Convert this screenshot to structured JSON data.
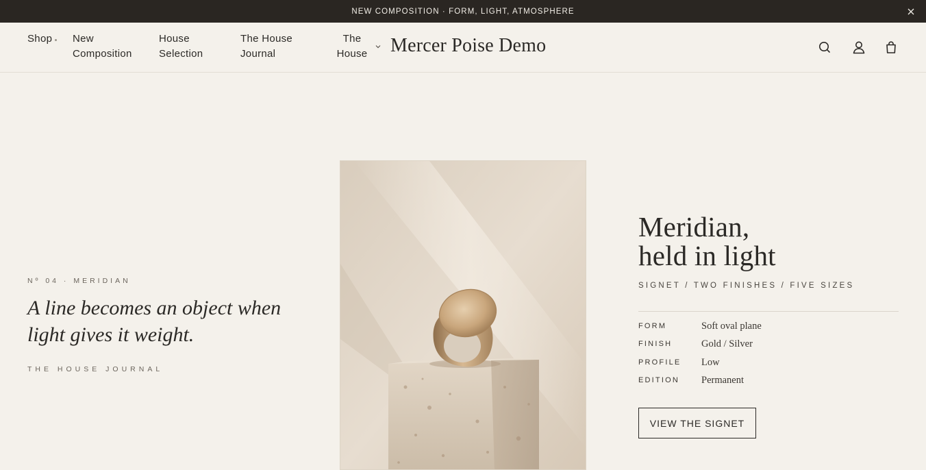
{
  "announcement": {
    "text": "NEW COMPOSITION · FORM, LIGHT, ATMOSPHERE",
    "close_icon": "close-icon"
  },
  "nav": {
    "shop": "Shop",
    "new_composition": "New Composition",
    "house_selection": "House Selection",
    "house_journal": "The House Journal",
    "the_house": "The House"
  },
  "brand": "Mercer Poise Demo",
  "header_icons": [
    "search-icon",
    "account-icon",
    "bag-icon"
  ],
  "left": {
    "eyebrow": "Nº 04 · MERIDIAN",
    "quote": "A line becomes an object when light gives it weight.",
    "link": "THE HOUSE JOURNAL"
  },
  "product": {
    "title_line1": "Meridian,",
    "title_line2": "held in light",
    "subtitle": "SIGNET / TWO FINISHES / FIVE SIZES",
    "specs": [
      {
        "key": "FORM",
        "value": "Soft oval plane"
      },
      {
        "key": "FINISH",
        "value": "Gold / Silver"
      },
      {
        "key": "PROFILE",
        "value": "Low"
      },
      {
        "key": "EDITION",
        "value": "Permanent"
      }
    ],
    "cta": "VIEW THE SIGNET"
  },
  "colors": {
    "background": "#f4f1eb",
    "announcement_bg": "#2a2622",
    "text": "#2b2926"
  }
}
